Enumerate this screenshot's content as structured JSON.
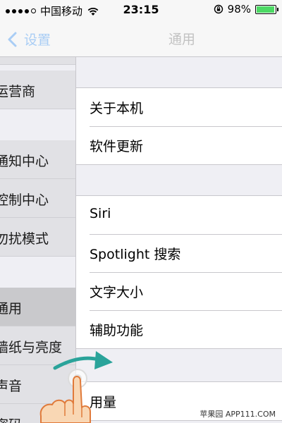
{
  "status_bar": {
    "carrier": "中国移动",
    "time": "23:15",
    "battery_percent": "98%",
    "battery_level": 0.98,
    "battery_color": "#4cd964"
  },
  "nav": {
    "back_label": "设置",
    "title": "通用"
  },
  "sidebar": {
    "items": [
      {
        "label": "运营商",
        "selected": false
      },
      {
        "label": "通知中心",
        "selected": false
      },
      {
        "label": "控制中心",
        "selected": false
      },
      {
        "label": "勿扰模式",
        "selected": false
      },
      {
        "label": "通用",
        "selected": true
      },
      {
        "label": "墙纸与亮度",
        "selected": false
      },
      {
        "label": "声音",
        "selected": false
      },
      {
        "label": "密码",
        "selected": false
      }
    ]
  },
  "detail": {
    "group1": [
      "关于本机",
      "软件更新"
    ],
    "group2": [
      "Siri",
      "Spotlight 搜索",
      "文字大小",
      "辅助功能"
    ],
    "group3": [
      "用量"
    ]
  },
  "watermark": "苹果园 APP111.COM",
  "colors": {
    "accent": "#a9cdf5",
    "arrow": "#2aa39a",
    "selected_row": "#c9c9cc"
  }
}
